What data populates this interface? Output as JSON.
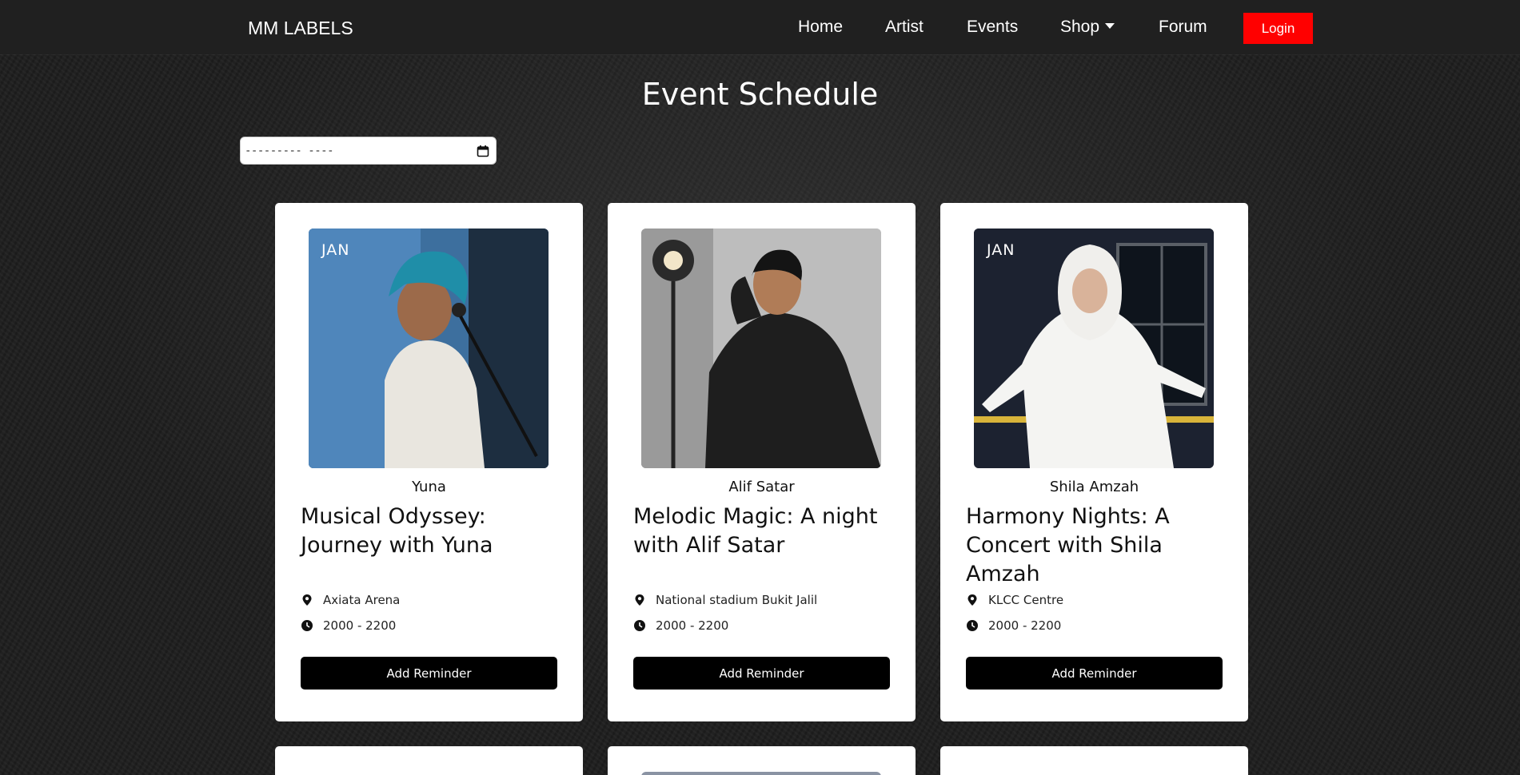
{
  "nav": {
    "brand": "MM LABELS",
    "links": [
      "Home",
      "Artist",
      "Events",
      "Shop",
      "Forum"
    ],
    "login": "Login"
  },
  "page": {
    "title": "Event Schedule",
    "date_input_value": "--------- ----"
  },
  "events": [
    {
      "month": "JAN",
      "artist": "Yuna",
      "title": "Musical Odyssey: Journey with Yuna",
      "venue": "Axiata Arena",
      "time": "2000 - 2200",
      "button": "Add Reminder"
    },
    {
      "month": "",
      "artist": "Alif Satar",
      "title": "Melodic Magic: A night with Alif Satar",
      "venue": "National stadium Bukit Jalil",
      "time": "2000 - 2200",
      "button": "Add Reminder"
    },
    {
      "month": "JAN",
      "artist": "Shila Amzah",
      "title": "Harmony Nights: A Concert with Shila Amzah",
      "venue": "KLCC Centre",
      "time": "2000 - 2200",
      "button": "Add Reminder"
    }
  ],
  "colors": {
    "login_bg": "#ff0000",
    "navbar_bg": "#202020",
    "button_bg": "#000000",
    "card_bg": "#ffffff"
  },
  "icons": {
    "venue": "map-pin-icon",
    "time": "clock-icon",
    "date": "calendar-icon",
    "shop": "chevron-down-icon"
  }
}
